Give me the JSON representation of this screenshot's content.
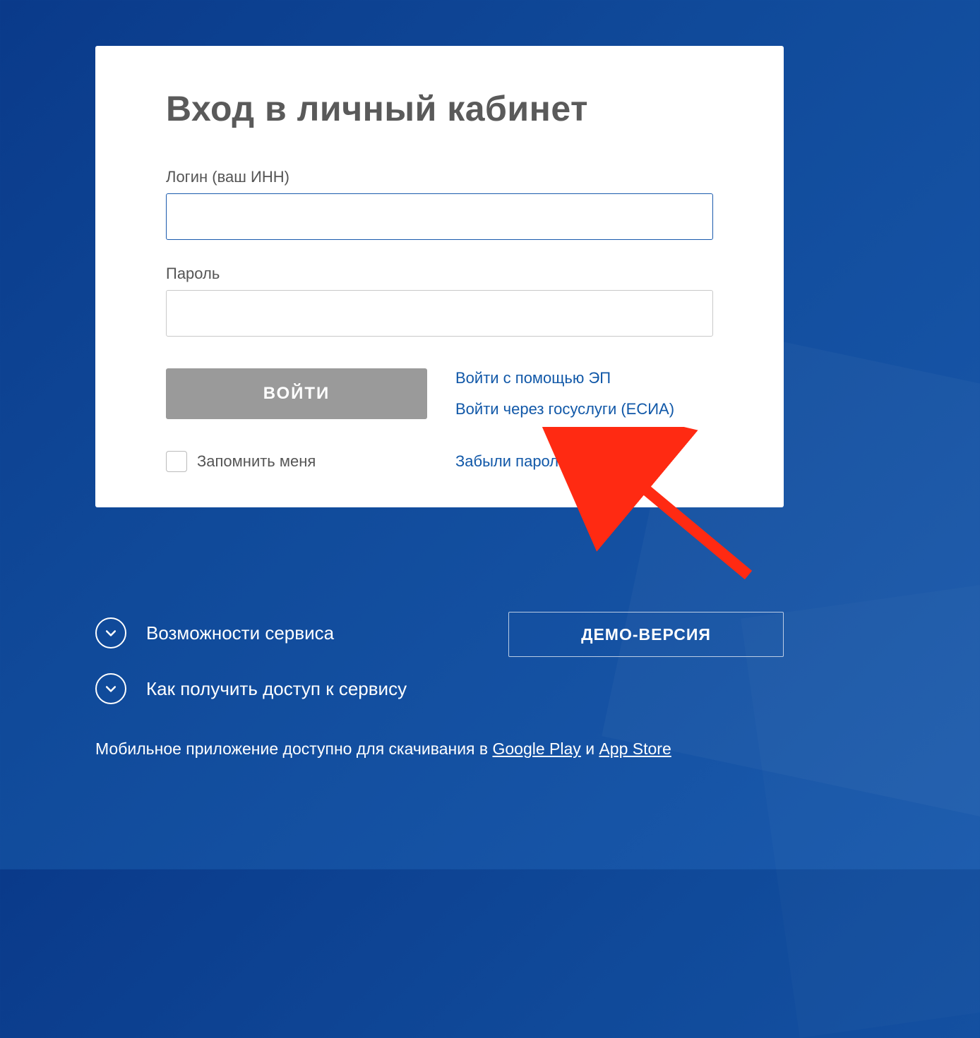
{
  "card": {
    "title": "Вход в личный кабинет",
    "login_label": "Логин (ваш ИНН)",
    "login_value": "",
    "password_label": "Пароль",
    "password_value": "",
    "submit_label": "ВОЙТИ",
    "alt_ep": "Войти с помощью ЭП",
    "alt_esia": "Войти через госуслуги (ЕСИА)",
    "remember_label": "Запомнить меня",
    "forgot_label": "Забыли пароль?"
  },
  "below": {
    "capabilities": "Возможности сервиса",
    "howto": "Как получить доступ к сервису",
    "demo": "ДЕМО-ВЕРСИЯ",
    "app_prefix": "Мобильное приложение доступно для скачивания в ",
    "google_play": "Google Play",
    "sep": " и ",
    "app_store": "App Store"
  }
}
